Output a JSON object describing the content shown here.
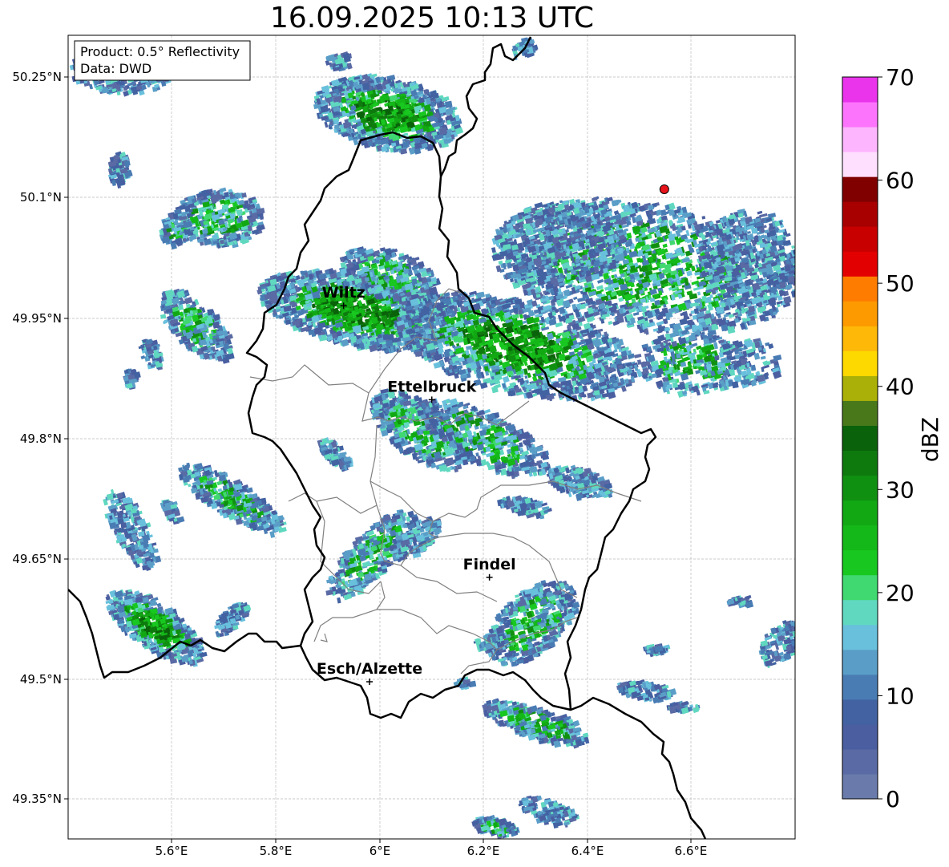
{
  "title": "16.09.2025 10:13 UTC",
  "info_box": {
    "product": "Product: 0.5° Reflectivity",
    "data": "Data: DWD"
  },
  "lat_ticks": [
    "50.25°N",
    "50.1°N",
    "49.95°N",
    "49.8°N",
    "49.65°N",
    "49.5°N",
    "49.35°N"
  ],
  "lon_ticks": [
    "5.6°E",
    "5.8°E",
    "6°E",
    "6.2°E",
    "6.4°E",
    "6.6°E"
  ],
  "cities": [
    {
      "name": "Wiltz",
      "lon": 5.93,
      "lat": 49.965
    },
    {
      "name": "Ettelbruck",
      "lon": 6.1,
      "lat": 49.848
    },
    {
      "name": "Findel",
      "lon": 6.211,
      "lat": 49.627
    },
    {
      "name": "Esch/Alzette",
      "lon": 5.98,
      "lat": 49.497
    }
  ],
  "radar_site": {
    "lon": 6.548,
    "lat": 50.11,
    "color": "#e8141c"
  },
  "colorbar": {
    "label": "dBZ",
    "ticks": [
      "0",
      "10",
      "20",
      "30",
      "40",
      "50",
      "60",
      "70"
    ],
    "colors": [
      "#6a7bab",
      "#5a6aa4",
      "#4a5ea0",
      "#4262a2",
      "#4a7cb4",
      "#5a9ec8",
      "#68c0dc",
      "#60d8c0",
      "#40d870",
      "#18c820",
      "#14b818",
      "#12a814",
      "#109010",
      "#0e7a0e",
      "#0a620a",
      "#48781a",
      "#aab008",
      "#fed900",
      "#fdb808",
      "#fd9a00",
      "#fe7c00",
      "#e20000",
      "#c80000",
      "#a80000",
      "#800000",
      "#fee0fe",
      "#fdb6fd",
      "#fc74fc",
      "#e934eb"
    ]
  }
}
